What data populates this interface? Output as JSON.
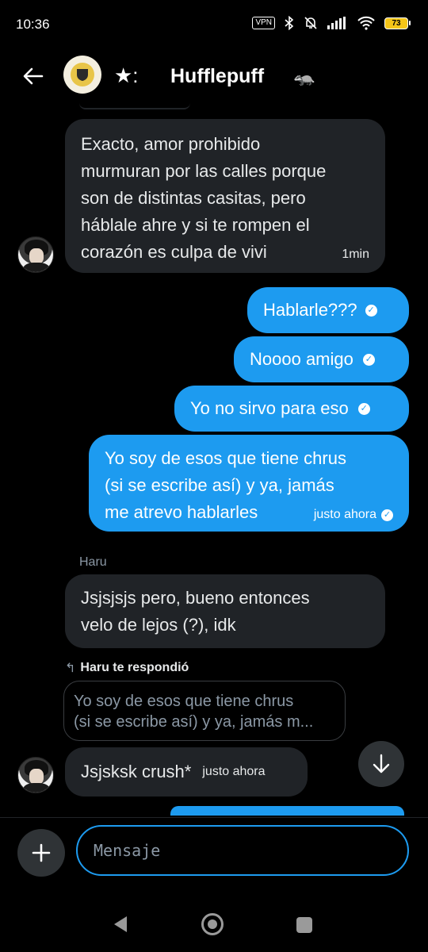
{
  "status_bar": {
    "time": "10:36",
    "vpn": "VPN",
    "battery": "73"
  },
  "header": {
    "title_prefix": "★:",
    "title": "Hufflepuff",
    "emoji": "🦡"
  },
  "messages": [
    {
      "direction": "in",
      "lines": [
        "Exacto, amor prohibido",
        "murmuran por las calles porque",
        "son de distintas casitas, pero",
        "háblale ahre y si te rompen el",
        "corazón es culpa de vivi"
      ],
      "time": "1min"
    },
    {
      "direction": "out",
      "text": "Hablarle???"
    },
    {
      "direction": "out",
      "text": "Noooo amigo"
    },
    {
      "direction": "out",
      "text": "Yo no sirvo para eso"
    },
    {
      "direction": "out",
      "lines": [
        "Yo soy de esos que tiene chrus",
        "(si se escribe así) y ya, jamás",
        "me atrevo hablarles"
      ],
      "time": "justo ahora"
    },
    {
      "direction": "in",
      "sender": "Haru",
      "lines": [
        "Jsjsjsjs pero, bueno entonces",
        "velo de lejos (?), idk"
      ]
    },
    {
      "direction": "in",
      "reply_label": "Haru te respondió",
      "quoted_lines": [
        "Yo soy de esos que tiene chrus",
        "(si se escribe así) y ya, jamás m..."
      ],
      "text": "Jsjsksk crush*",
      "time": "justo ahora"
    }
  ],
  "composer": {
    "placeholder": "Mensaje"
  }
}
